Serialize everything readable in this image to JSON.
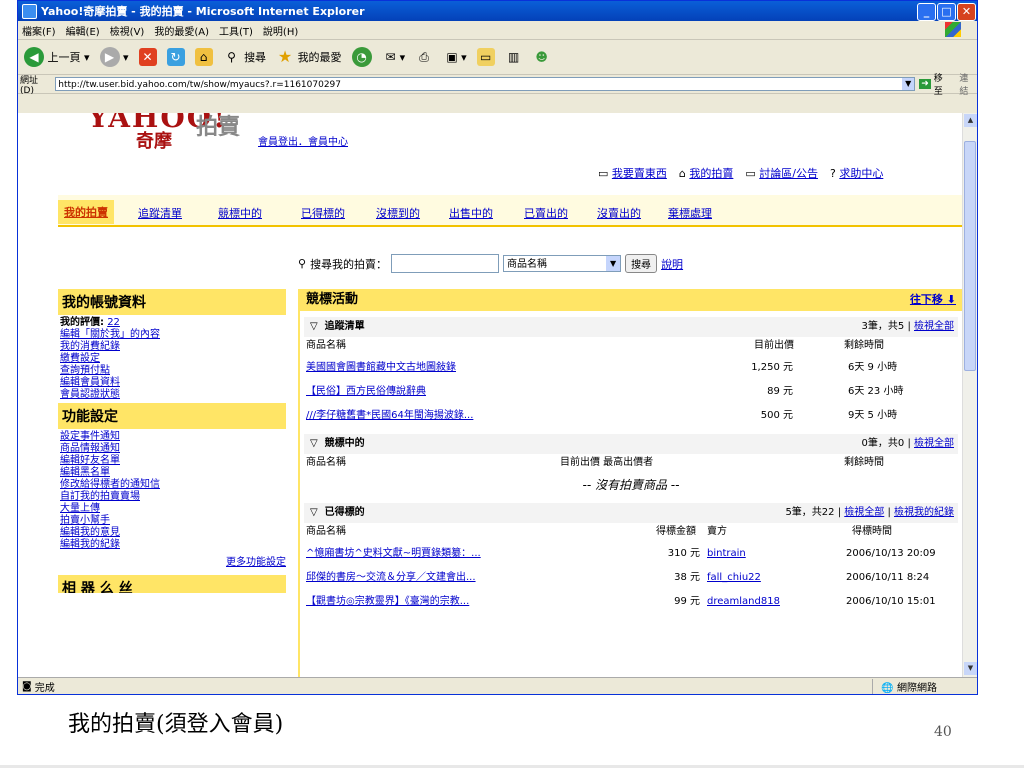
{
  "window": {
    "title": "Yahoo!奇摩拍賣 - 我的拍賣 - Microsoft Internet Explorer"
  },
  "menu": [
    "檔案(F)",
    "編輯(E)",
    "檢視(V)",
    "我的最愛(A)",
    "工具(T)",
    "說明(H)"
  ],
  "toolbar": {
    "back": "上一頁",
    "search": "搜尋",
    "favorites": "我的最愛"
  },
  "address": {
    "label": "網址(D)",
    "url": "http://tw.user.bid.yahoo.com/tw/show/myaucs?.r=1161070297",
    "go": "移至",
    "links": "連結"
  },
  "site": {
    "logo_y": "YAHOO!",
    "logo_q": "奇摩",
    "logo_p": "拍賣",
    "login_links": "會員登出．會員中心"
  },
  "toplinks": [
    "我要賣東西",
    "我的拍賣",
    "討論區/公告",
    "求助中心"
  ],
  "tabs": [
    "我的拍賣",
    "追蹤清單",
    "競標中的",
    "已得標的",
    "沒標到的",
    "出售中的",
    "已賣出的",
    "沒賣出的",
    "棄標處理"
  ],
  "search": {
    "label": "搜尋我的拍賣：",
    "select": "商品名稱",
    "button": "搜尋",
    "help": "說明"
  },
  "left": {
    "account_title": "我的帳號資料",
    "rating_label": "我的評價:",
    "rating_value": "22",
    "account_links": [
      "編輯「關於我」的內容",
      "我的消費紀錄",
      "繳費設定",
      "查詢預付點",
      "編輯會員資料",
      "會員認證狀態"
    ],
    "func_title": "功能設定",
    "func_links": [
      "設定事件通知",
      "商品情報通知",
      "編輯好友名單",
      "編輯黑名單",
      "修改給得標者的通知信",
      "自訂我的拍賣賣場",
      "大量上傳",
      "拍賣小幫手",
      "編輯我的意見",
      "編輯我的紀錄"
    ],
    "more": "更多功能設定",
    "cut_title": "相 器 么 丝"
  },
  "main": {
    "title": "競標活動",
    "down": "往下移",
    "watch": {
      "title": "追蹤清單",
      "summary": "3筆，共5 | ",
      "viewall": "檢視全部",
      "cols": [
        "商品名稱",
        "目前出價",
        "剩餘時間"
      ],
      "rows": [
        {
          "name": "美國國會圖書館藏中文古地圖敍錄",
          "price": "1,250 元",
          "time": "6天 9 小時"
        },
        {
          "name": "【民俗】西方民俗傳說辭典",
          "price": "89 元",
          "time": "6天 23 小時"
        },
        {
          "name": "///李仔糖舊書*民國64年閩海揚波錄...",
          "price": "500 元",
          "time": "9天 5 小時"
        }
      ]
    },
    "bidding": {
      "title": "競標中的",
      "summary": "0筆，共0 | ",
      "viewall": "檢視全部",
      "cols": [
        "商品名稱",
        "目前出價 最高出價者",
        "剩餘時間"
      ],
      "empty": "-- 沒有拍賣商品 --"
    },
    "won": {
      "title": "已得標的",
      "summary": "5筆，共22 | ",
      "viewall": "檢視全部",
      "viewrec": "檢視我的紀錄",
      "cols": [
        "商品名稱",
        "得標金額",
        "賣方",
        "得標時間"
      ],
      "rows": [
        {
          "name": "^憶廂書坊^史料文獻~明賈錄類纂：...",
          "price": "310 元",
          "seller": "bintrain",
          "time": "2006/10/13 20:09"
        },
        {
          "name": "邱傑的書房～交流＆分享／文建會出...",
          "price": "38 元",
          "seller": "fall_chiu22",
          "time": "2006/10/11 8:24"
        },
        {
          "name": "【觀書坊◎宗教靈界】《臺灣的宗教...",
          "price": "99 元",
          "seller": "dreamland818",
          "time": "2006/10/10 15:01"
        }
      ]
    }
  },
  "status": {
    "left": "完成",
    "zone": "網際網路"
  },
  "slide": {
    "caption": "我的拍賣(須登入會員)",
    "page": "40"
  }
}
